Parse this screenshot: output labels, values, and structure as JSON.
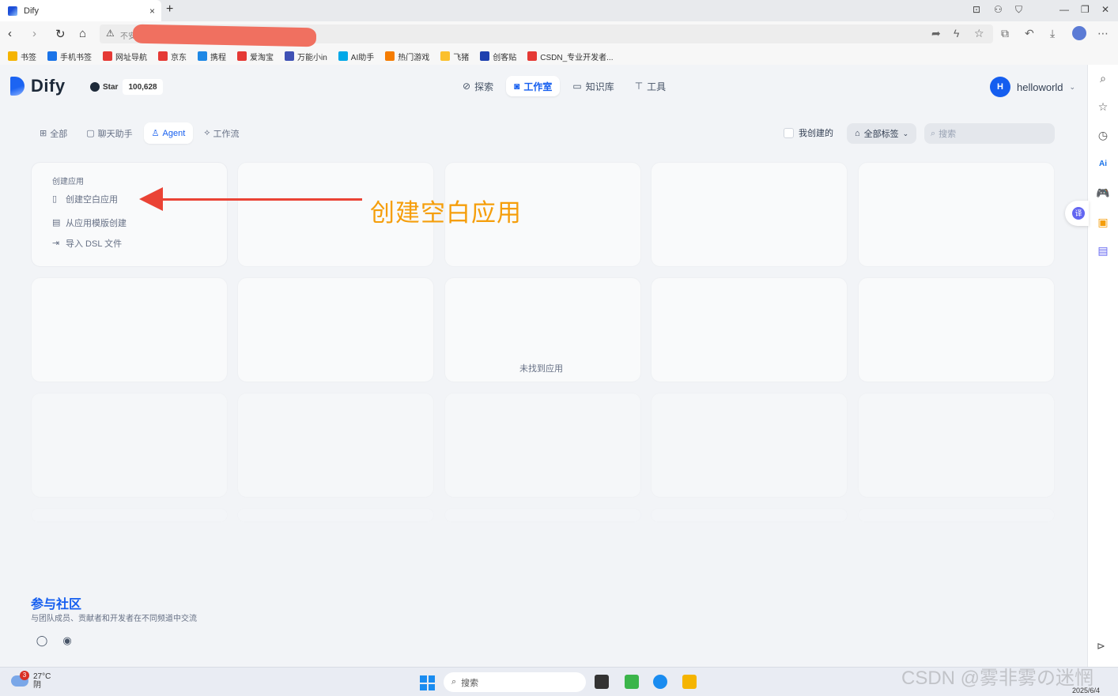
{
  "browser": {
    "tab_title": "Dify",
    "tab_close": "×",
    "new_tab": "+",
    "url_prefix": "不安",
    "bookmarks": [
      {
        "label": "书签",
        "color": "#f5b400"
      },
      {
        "label": "手机书签",
        "color": "#1a73e8"
      },
      {
        "label": "网址导航",
        "color": "#e53935"
      },
      {
        "label": "京东",
        "color": "#e53935"
      },
      {
        "label": "携程",
        "color": "#1e88e5"
      },
      {
        "label": "爱淘宝",
        "color": "#e53935"
      },
      {
        "label": "万能小in",
        "color": "#3f51b5"
      },
      {
        "label": "AI助手",
        "color": "#00a8e8"
      },
      {
        "label": "热门游戏",
        "color": "#f57c00"
      },
      {
        "label": "飞猪",
        "color": "#fbc02d"
      },
      {
        "label": "创客贴",
        "color": "#1e40af"
      },
      {
        "label": "CSDN_专业开发者...",
        "color": "#e53935"
      }
    ]
  },
  "app": {
    "logo_text": "Dify",
    "star_label": "Star",
    "star_count": "100,628",
    "nav": [
      {
        "label": "探索",
        "icon": "compass-icon",
        "active": false
      },
      {
        "label": "工作室",
        "icon": "robot-icon",
        "active": true
      },
      {
        "label": "知识库",
        "icon": "book-icon",
        "active": false
      },
      {
        "label": "工具",
        "icon": "hammer-icon",
        "active": false
      }
    ],
    "user": {
      "initial": "H",
      "name": "helloworld"
    }
  },
  "filters": {
    "tabs": [
      {
        "label": "全部",
        "icon": "grid-icon",
        "active": false
      },
      {
        "label": "聊天助手",
        "icon": "chat-icon",
        "active": false
      },
      {
        "label": "Agent",
        "icon": "agent-icon",
        "active": true
      },
      {
        "label": "工作流",
        "icon": "workflow-icon",
        "active": false
      }
    ],
    "mine_label": "我创建的",
    "tags_label": "全部标签",
    "search_placeholder": "搜索"
  },
  "create_card": {
    "title": "创建应用",
    "options": [
      {
        "label": "创建空白应用",
        "icon": "file-plus-icon"
      },
      {
        "label": "从应用模版创建",
        "icon": "template-icon"
      },
      {
        "label": "导入 DSL 文件",
        "icon": "import-icon"
      }
    ]
  },
  "empty_text": "未找到应用",
  "annotation": "创建空白应用",
  "community": {
    "title": "参与社区",
    "desc": "与团队成员、贡献者和开发者在不同频道中交流"
  },
  "taskbar": {
    "weather_temp": "27°C",
    "weather_desc": "阴",
    "weather_badge": "3",
    "search_label": "搜索",
    "date": "2025/6/4"
  },
  "watermark": "CSDN @雾非雾の迷惘",
  "colors": {
    "accent": "#155eef",
    "annotation_arrow": "#ea4335",
    "annotation_text": "#f59e0b"
  }
}
